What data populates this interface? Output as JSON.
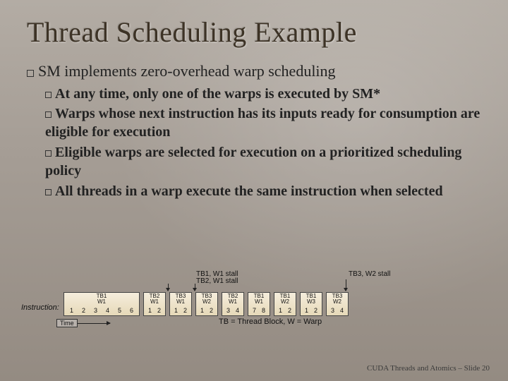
{
  "title": "Thread Scheduling Example",
  "bullets": {
    "top": "SM implements zero-overhead warp scheduling",
    "sub": [
      "At any time, only one of the warps is executed by SM*",
      "Warps whose next instruction has its inputs ready for consumption are eligible for execution",
      "Eligible warps are selected for execution on a prioritized scheduling policy",
      "All threads in a warp execute the same instruction when selected"
    ]
  },
  "diagram": {
    "instruction_label": "Instruction:",
    "stall_tb1_lines": [
      "TB1, W1 stall",
      "TB2, W1 stall"
    ],
    "stall_tb3_line": "TB3, W2 stall",
    "time_label": "Time",
    "legend": "TB = Thread Block, W = Warp",
    "blocks": [
      {
        "tb": "TB1",
        "w": "W1",
        "nums": [
          "1",
          "2",
          "3",
          "4",
          "5",
          "6"
        ],
        "w_each": 18
      },
      {
        "tb": "TB2",
        "w": "W1",
        "nums": [
          "1",
          "2"
        ],
        "w_each": 16
      },
      {
        "tb": "TB3",
        "w": "W1",
        "nums": [
          "1",
          "2"
        ],
        "w_each": 16
      },
      {
        "tb": "TB3",
        "w": "W2",
        "nums": [
          "1",
          "2"
        ],
        "w_each": 16
      },
      {
        "tb": "TB2",
        "w": "W1",
        "nums": [
          "3",
          "4"
        ],
        "w_each": 16
      },
      {
        "tb": "TB1",
        "w": "W1",
        "nums": [
          "7",
          "8"
        ],
        "w_each": 16
      },
      {
        "tb": "TB1",
        "w": "W2",
        "nums": [
          "1",
          "2"
        ],
        "w_each": 16
      },
      {
        "tb": "TB1",
        "w": "W3",
        "nums": [
          "1",
          "2"
        ],
        "w_each": 16
      },
      {
        "tb": "TB3",
        "w": "W2",
        "nums": [
          "3",
          "4"
        ],
        "w_each": 16
      }
    ]
  },
  "footer": "CUDA Threads and Atomics – Slide  20"
}
